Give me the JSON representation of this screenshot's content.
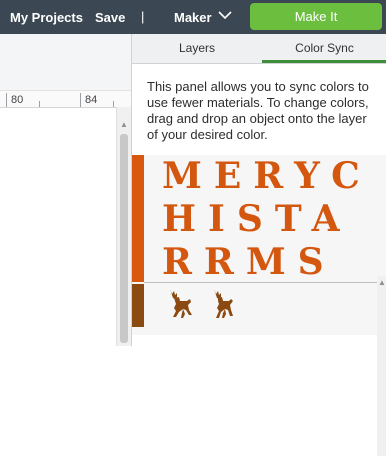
{
  "topbar": {
    "my_projects": "My Projects",
    "save": "Save",
    "separator": "|",
    "maker": "Maker",
    "make_it": "Make It"
  },
  "ruler": {
    "labels": [
      "80",
      "84"
    ]
  },
  "panel": {
    "tabs": [
      "Layers",
      "Color Sync"
    ],
    "active_tab": "Color Sync",
    "description": "This panel allows you to sync colors to use fewer materials. To change colors, drag and drop an object onto the layer of your desired color.",
    "layers": [
      {
        "color": "#d9580f",
        "text_lines": [
          "MERYC",
          "HISTA",
          "RRMS"
        ]
      },
      {
        "color": "#8b4a12",
        "icons": [
          "reindeer-icon",
          "reindeer-icon"
        ]
      }
    ]
  },
  "colors": {
    "topbar": "#3b4752",
    "accent": "#6cbe3f",
    "tab_underline": "#3f8f3a"
  }
}
